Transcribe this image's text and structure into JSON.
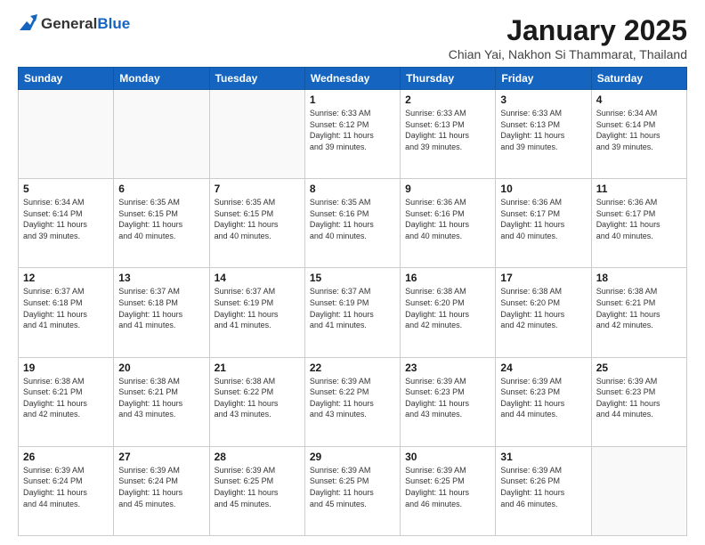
{
  "header": {
    "logo_general": "General",
    "logo_blue": "Blue",
    "month": "January 2025",
    "location": "Chian Yai, Nakhon Si Thammarat, Thailand"
  },
  "days_of_week": [
    "Sunday",
    "Monday",
    "Tuesday",
    "Wednesday",
    "Thursday",
    "Friday",
    "Saturday"
  ],
  "weeks": [
    [
      {
        "day": "",
        "info": ""
      },
      {
        "day": "",
        "info": ""
      },
      {
        "day": "",
        "info": ""
      },
      {
        "day": "1",
        "info": "Sunrise: 6:33 AM\nSunset: 6:12 PM\nDaylight: 11 hours\nand 39 minutes."
      },
      {
        "day": "2",
        "info": "Sunrise: 6:33 AM\nSunset: 6:13 PM\nDaylight: 11 hours\nand 39 minutes."
      },
      {
        "day": "3",
        "info": "Sunrise: 6:33 AM\nSunset: 6:13 PM\nDaylight: 11 hours\nand 39 minutes."
      },
      {
        "day": "4",
        "info": "Sunrise: 6:34 AM\nSunset: 6:14 PM\nDaylight: 11 hours\nand 39 minutes."
      }
    ],
    [
      {
        "day": "5",
        "info": "Sunrise: 6:34 AM\nSunset: 6:14 PM\nDaylight: 11 hours\nand 39 minutes."
      },
      {
        "day": "6",
        "info": "Sunrise: 6:35 AM\nSunset: 6:15 PM\nDaylight: 11 hours\nand 40 minutes."
      },
      {
        "day": "7",
        "info": "Sunrise: 6:35 AM\nSunset: 6:15 PM\nDaylight: 11 hours\nand 40 minutes."
      },
      {
        "day": "8",
        "info": "Sunrise: 6:35 AM\nSunset: 6:16 PM\nDaylight: 11 hours\nand 40 minutes."
      },
      {
        "day": "9",
        "info": "Sunrise: 6:36 AM\nSunset: 6:16 PM\nDaylight: 11 hours\nand 40 minutes."
      },
      {
        "day": "10",
        "info": "Sunrise: 6:36 AM\nSunset: 6:17 PM\nDaylight: 11 hours\nand 40 minutes."
      },
      {
        "day": "11",
        "info": "Sunrise: 6:36 AM\nSunset: 6:17 PM\nDaylight: 11 hours\nand 40 minutes."
      }
    ],
    [
      {
        "day": "12",
        "info": "Sunrise: 6:37 AM\nSunset: 6:18 PM\nDaylight: 11 hours\nand 41 minutes."
      },
      {
        "day": "13",
        "info": "Sunrise: 6:37 AM\nSunset: 6:18 PM\nDaylight: 11 hours\nand 41 minutes."
      },
      {
        "day": "14",
        "info": "Sunrise: 6:37 AM\nSunset: 6:19 PM\nDaylight: 11 hours\nand 41 minutes."
      },
      {
        "day": "15",
        "info": "Sunrise: 6:37 AM\nSunset: 6:19 PM\nDaylight: 11 hours\nand 41 minutes."
      },
      {
        "day": "16",
        "info": "Sunrise: 6:38 AM\nSunset: 6:20 PM\nDaylight: 11 hours\nand 42 minutes."
      },
      {
        "day": "17",
        "info": "Sunrise: 6:38 AM\nSunset: 6:20 PM\nDaylight: 11 hours\nand 42 minutes."
      },
      {
        "day": "18",
        "info": "Sunrise: 6:38 AM\nSunset: 6:21 PM\nDaylight: 11 hours\nand 42 minutes."
      }
    ],
    [
      {
        "day": "19",
        "info": "Sunrise: 6:38 AM\nSunset: 6:21 PM\nDaylight: 11 hours\nand 42 minutes."
      },
      {
        "day": "20",
        "info": "Sunrise: 6:38 AM\nSunset: 6:21 PM\nDaylight: 11 hours\nand 43 minutes."
      },
      {
        "day": "21",
        "info": "Sunrise: 6:38 AM\nSunset: 6:22 PM\nDaylight: 11 hours\nand 43 minutes."
      },
      {
        "day": "22",
        "info": "Sunrise: 6:39 AM\nSunset: 6:22 PM\nDaylight: 11 hours\nand 43 minutes."
      },
      {
        "day": "23",
        "info": "Sunrise: 6:39 AM\nSunset: 6:23 PM\nDaylight: 11 hours\nand 43 minutes."
      },
      {
        "day": "24",
        "info": "Sunrise: 6:39 AM\nSunset: 6:23 PM\nDaylight: 11 hours\nand 44 minutes."
      },
      {
        "day": "25",
        "info": "Sunrise: 6:39 AM\nSunset: 6:23 PM\nDaylight: 11 hours\nand 44 minutes."
      }
    ],
    [
      {
        "day": "26",
        "info": "Sunrise: 6:39 AM\nSunset: 6:24 PM\nDaylight: 11 hours\nand 44 minutes."
      },
      {
        "day": "27",
        "info": "Sunrise: 6:39 AM\nSunset: 6:24 PM\nDaylight: 11 hours\nand 45 minutes."
      },
      {
        "day": "28",
        "info": "Sunrise: 6:39 AM\nSunset: 6:25 PM\nDaylight: 11 hours\nand 45 minutes."
      },
      {
        "day": "29",
        "info": "Sunrise: 6:39 AM\nSunset: 6:25 PM\nDaylight: 11 hours\nand 45 minutes."
      },
      {
        "day": "30",
        "info": "Sunrise: 6:39 AM\nSunset: 6:25 PM\nDaylight: 11 hours\nand 46 minutes."
      },
      {
        "day": "31",
        "info": "Sunrise: 6:39 AM\nSunset: 6:26 PM\nDaylight: 11 hours\nand 46 minutes."
      },
      {
        "day": "",
        "info": ""
      }
    ]
  ]
}
